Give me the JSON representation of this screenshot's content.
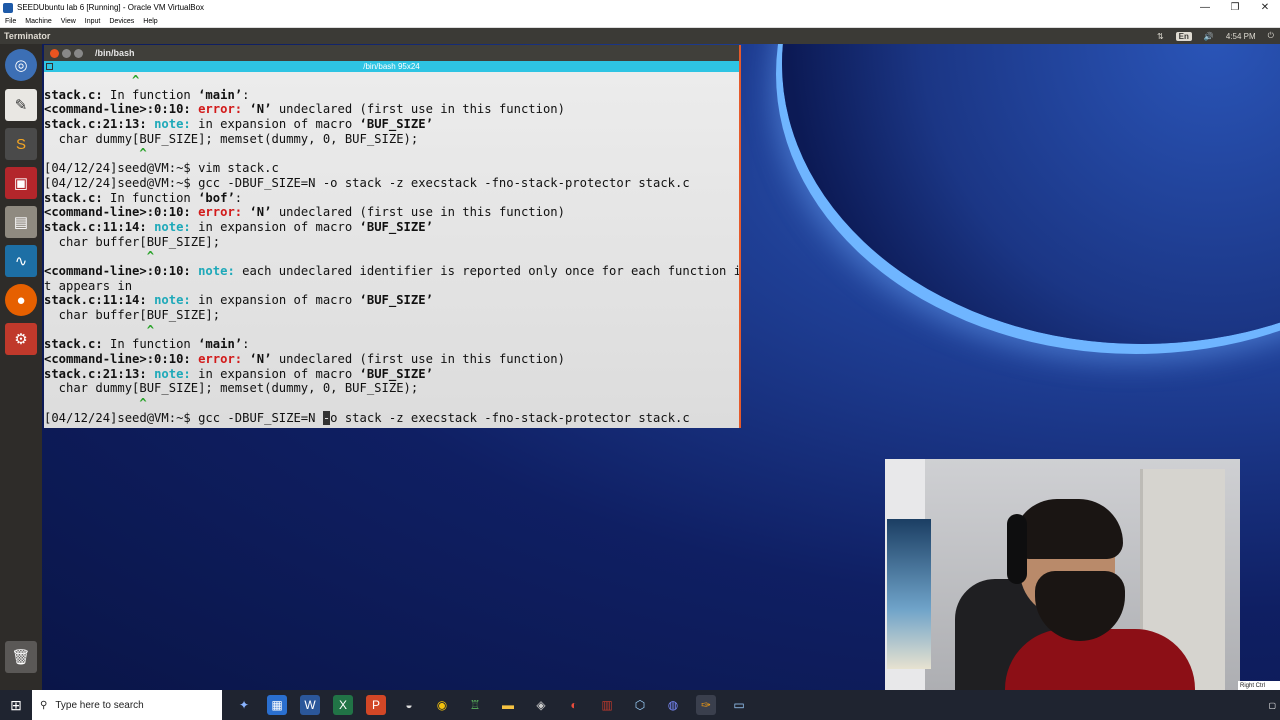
{
  "vbox": {
    "title": "SEEDUbuntu lab 6 [Running] - Oracle VM VirtualBox",
    "menu": [
      "File",
      "Machine",
      "View",
      "Input",
      "Devices",
      "Help"
    ],
    "controls": {
      "minimize": "—",
      "restore": "❐",
      "close": "✕"
    }
  },
  "panel": {
    "app_title": "Terminator",
    "keyboard": "En",
    "time": "4:54 PM",
    "icons": [
      "sort-icon",
      "volume-icon",
      "settings-icon"
    ]
  },
  "launcher": {
    "items": [
      "dash",
      "text-editor",
      "sublime",
      "terminal",
      "file-manager",
      "wireshark",
      "firefox",
      "settings",
      "trash"
    ]
  },
  "terminal": {
    "window_title": "/bin/bash",
    "tab_title": "/bin/bash 95x24",
    "lines": [
      [
        {
          "t": "            ^",
          "c": "caret"
        }
      ],
      [
        {
          "t": "stack.c:",
          "c": "b"
        },
        {
          "t": " In function "
        },
        {
          "t": "‘main’",
          "c": "b"
        },
        {
          "t": ":"
        }
      ],
      [
        {
          "t": "<command-line>:0:10:",
          "c": "b"
        },
        {
          "t": " "
        },
        {
          "t": "error:",
          "c": "err"
        },
        {
          "t": " "
        },
        {
          "t": "‘N’",
          "c": "b"
        },
        {
          "t": " undeclared (first use in this function)"
        }
      ],
      [
        {
          "t": "stack.c:21:13:",
          "c": "b"
        },
        {
          "t": " "
        },
        {
          "t": "note:",
          "c": "note"
        },
        {
          "t": " in expansion of macro "
        },
        {
          "t": "‘BUF_SIZE’",
          "c": "b"
        }
      ],
      [
        {
          "t": "  char dummy[BUF_SIZE]; memset(dummy, 0, BUF_SIZE);"
        }
      ],
      [
        {
          "t": "             ^",
          "c": "caret"
        }
      ],
      [
        {
          "t": "[04/12/24]seed@VM:~$ vim stack.c"
        }
      ],
      [
        {
          "t": "[04/12/24]seed@VM:~$ gcc -DBUF_SIZE=N -o stack -z execstack -fno-stack-protector stack.c"
        }
      ],
      [
        {
          "t": "stack.c:",
          "c": "b"
        },
        {
          "t": " In function "
        },
        {
          "t": "‘bof’",
          "c": "b"
        },
        {
          "t": ":"
        }
      ],
      [
        {
          "t": "<command-line>:0:10:",
          "c": "b"
        },
        {
          "t": " "
        },
        {
          "t": "error:",
          "c": "err"
        },
        {
          "t": " "
        },
        {
          "t": "‘N’",
          "c": "b"
        },
        {
          "t": " undeclared (first use in this function)"
        }
      ],
      [
        {
          "t": "stack.c:11:14:",
          "c": "b"
        },
        {
          "t": " "
        },
        {
          "t": "note:",
          "c": "note"
        },
        {
          "t": " in expansion of macro "
        },
        {
          "t": "‘BUF_SIZE’",
          "c": "b"
        }
      ],
      [
        {
          "t": "  char buffer[BUF_SIZE];"
        }
      ],
      [
        {
          "t": "              ^",
          "c": "caret"
        }
      ],
      [
        {
          "t": "<command-line>:0:10:",
          "c": "b"
        },
        {
          "t": " "
        },
        {
          "t": "note:",
          "c": "note"
        },
        {
          "t": " each undeclared identifier is reported only once for each function i"
        }
      ],
      [
        {
          "t": "t appears in"
        }
      ],
      [
        {
          "t": "stack.c:11:14:",
          "c": "b"
        },
        {
          "t": " "
        },
        {
          "t": "note:",
          "c": "note"
        },
        {
          "t": " in expansion of macro "
        },
        {
          "t": "‘BUF_SIZE’",
          "c": "b"
        }
      ],
      [
        {
          "t": "  char buffer[BUF_SIZE];"
        }
      ],
      [
        {
          "t": "              ^",
          "c": "caret"
        }
      ],
      [
        {
          "t": "stack.c:",
          "c": "b"
        },
        {
          "t": " In function "
        },
        {
          "t": "‘main’",
          "c": "b"
        },
        {
          "t": ":"
        }
      ],
      [
        {
          "t": "<command-line>:0:10:",
          "c": "b"
        },
        {
          "t": " "
        },
        {
          "t": "error:",
          "c": "err"
        },
        {
          "t": " "
        },
        {
          "t": "‘N’",
          "c": "b"
        },
        {
          "t": " undeclared (first use in this function)"
        }
      ],
      [
        {
          "t": "stack.c:21:13:",
          "c": "b"
        },
        {
          "t": " "
        },
        {
          "t": "note:",
          "c": "note"
        },
        {
          "t": " in expansion of macro "
        },
        {
          "t": "‘BUF_SIZE’",
          "c": "b"
        }
      ],
      [
        {
          "t": "  char dummy[BUF_SIZE]; memset(dummy, 0, BUF_SIZE);"
        }
      ],
      [
        {
          "t": "             ^",
          "c": "caret"
        }
      ],
      [
        {
          "t": "[04/12/24]seed@VM:~$ gcc -DBUF_SIZE=N "
        },
        {
          "t": "-",
          "c": "cursor"
        },
        {
          "t": "o stack -z execstack -fno-stack-protector stack.c"
        }
      ]
    ]
  },
  "taskbar": {
    "search_placeholder": "Type here to search",
    "apps": [
      "file-explorer",
      "word",
      "excel",
      "powerpoint",
      "app",
      "chrome",
      "app",
      "folder",
      "app",
      "app",
      "winrar",
      "virtualbox",
      "app",
      "app",
      "notepad"
    ],
    "tray_badge": "Right Ctrl"
  },
  "colors": {
    "error": "#d21a1a",
    "note": "#1ea9b9",
    "caret": "#2aa32a",
    "tab_accent": "#2ec4e3",
    "window_border": "#e55a2b",
    "desktop": "#1f3f95",
    "panel": "#3b3a36",
    "launcher": "#2e2c29",
    "taskbar": "#1f2430"
  }
}
